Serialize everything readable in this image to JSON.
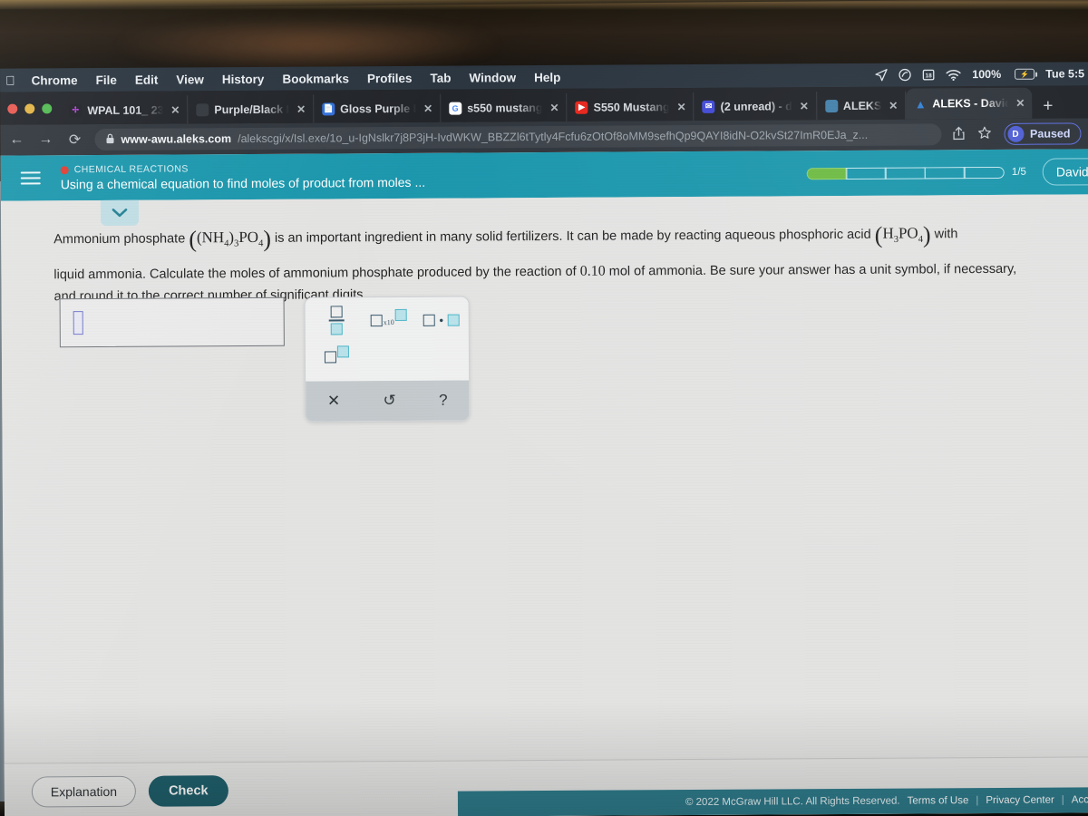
{
  "menubar": {
    "apple_icon": "apple-icon",
    "items": [
      "Chrome",
      "File",
      "Edit",
      "View",
      "History",
      "Bookmarks",
      "Profiles",
      "Tab",
      "Window",
      "Help"
    ],
    "status": {
      "location_icon": "location-arrow-icon",
      "creative_cloud_icon": "creative-cloud-icon",
      "calendar_icon": "calendar-icon",
      "wifi_icon": "wifi-icon",
      "battery_percent": "100%",
      "battery_icon": "battery-charging-icon",
      "clock": "Tue 5:5"
    }
  },
  "browser": {
    "tabs": [
      {
        "title": "WPAL 101_ 23",
        "favicon": "wpal-icon",
        "active": false
      },
      {
        "title": "Purple/Black I",
        "favicon": "generic-icon",
        "active": false
      },
      {
        "title": "Gloss Purple B",
        "favicon": "blue-doc-icon",
        "active": false
      },
      {
        "title": "s550 mustang",
        "favicon": "google-icon",
        "active": false
      },
      {
        "title": "S550 Mustang",
        "favicon": "youtube-icon",
        "active": false
      },
      {
        "title": "(2 unread) - d",
        "favicon": "mail-icon",
        "active": false
      },
      {
        "title": "ALEKS",
        "favicon": "aleks-icon",
        "active": false
      },
      {
        "title": "ALEKS - David",
        "favicon": "aleks-a-icon",
        "active": true
      }
    ],
    "new_tab_label": "+",
    "close_label": "✕",
    "nav": {
      "back": "←",
      "forward": "→",
      "reload": "⟳",
      "lock_icon": "lock-icon"
    },
    "url": {
      "host": "www-awu.aleks.com",
      "path": "/alekscgi/x/Isl.exe/1o_u-IgNslkr7j8P3jH-IvdWKW_BBZZl6tTytly4Fcfu6zOtOf8oMM9sefhQp9QAYI8idN-O2kvSt27ImR0EJa_z..."
    },
    "share_icon": "share-icon",
    "bookmark_icon": "star-icon",
    "profile": {
      "avatar_letter": "D",
      "label": "Paused"
    }
  },
  "aleks": {
    "menu_icon": "hamburger-menu-icon",
    "kicker": "CHEMICAL REACTIONS",
    "kicker_dot_color": "#e03a2f",
    "title": "Using a chemical equation to find moles of product from moles ...",
    "progress": {
      "total": 5,
      "completed": 1,
      "label": "1/5",
      "fill_color": "#6ab93f"
    },
    "user_button": {
      "name": "David",
      "chevron": "▾"
    },
    "collapse_icon": "chevron-down-icon",
    "header_color": "#1795ab",
    "question": {
      "line1_a": "Ammonium phosphate",
      "formula1_open": "(",
      "formula1": "(NH4)3PO4",
      "formula1_close": ")",
      "line1_b": "is an important ingredient in many solid fertilizers. It can be made by reacting aqueous phosphoric acid",
      "formula2_open": "(",
      "formula2": "H3PO4",
      "formula2_close": ")",
      "line1_c": "with",
      "line2_a": "liquid ammonia. Calculate the moles of ammonium phosphate produced by the reaction of",
      "amount": "0.10",
      "line2_b": "mol of ammonia. Be sure your answer has a unit symbol, if",
      "line3": "necessary, and round it to the correct number of significant digits."
    },
    "answer_input": {
      "value": "",
      "caret": "text-caret"
    },
    "palette": {
      "buttons": [
        {
          "name": "fraction-button",
          "label": "□/□"
        },
        {
          "name": "scientific-notation-button",
          "label": "□ x10 □"
        },
        {
          "name": "multiply-button",
          "label": "□ · □"
        },
        {
          "name": "exponent-button",
          "label": "□^□"
        }
      ],
      "footer": [
        {
          "name": "clear-button",
          "glyph": "✕"
        },
        {
          "name": "undo-button",
          "glyph": "↺"
        },
        {
          "name": "help-button",
          "glyph": "?"
        }
      ]
    },
    "buttons": {
      "explanation": "Explanation",
      "check": "Check"
    },
    "footer": {
      "copyright": "© 2022 McGraw Hill LLC. All Rights Reserved.",
      "links": [
        "Terms of Use",
        "Privacy Center",
        "Acc"
      ],
      "separator": "|"
    }
  }
}
